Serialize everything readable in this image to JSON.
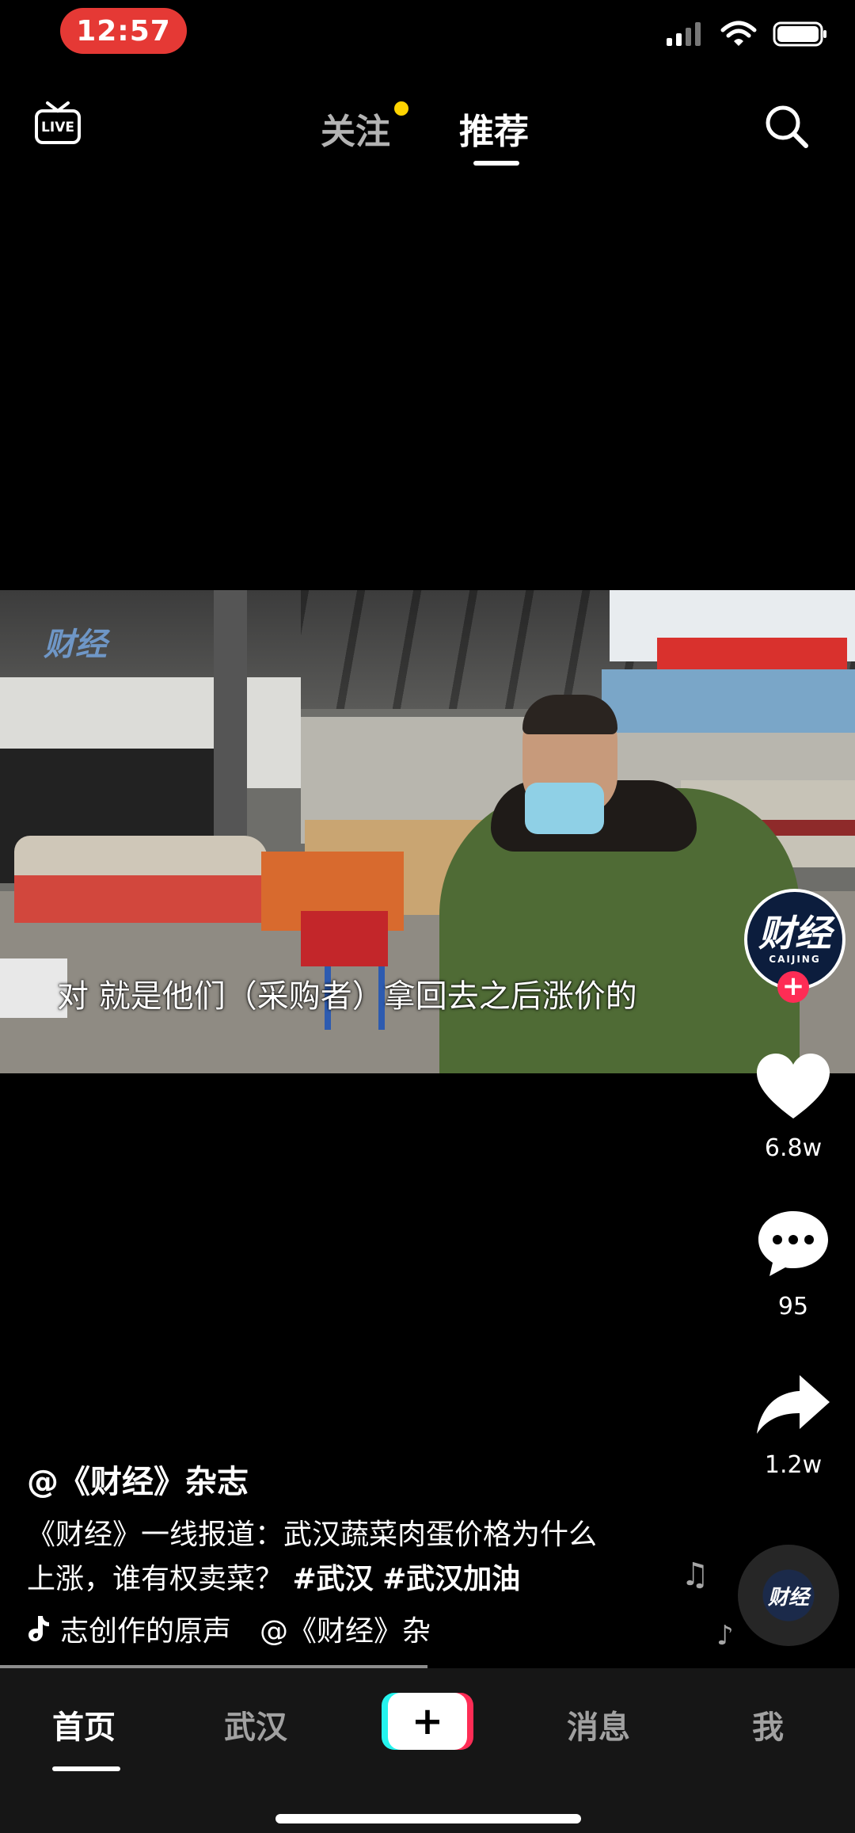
{
  "status_bar": {
    "time": "12:57"
  },
  "top_nav": {
    "live_label": "LIVE",
    "tab_follow": "关注",
    "tab_recommend": "推荐"
  },
  "video": {
    "watermark": "财经",
    "subtitle": "对 就是他们（采购者）拿回去之后涨价的"
  },
  "actions": {
    "avatar_text": "财经",
    "avatar_sub": "CAIJING",
    "follow_plus": "+",
    "like_count": "6.8w",
    "comment_count": "95",
    "share_count": "1.2w"
  },
  "caption": {
    "author": "@《财经》杂志",
    "desc_line1": "《财经》一线报道：武汉蔬菜肉蛋价格为什么",
    "desc_line2_text": "上涨，谁有权卖菜？",
    "hashtags": [
      "#武汉",
      "#武汉加油"
    ],
    "music": "志创作的原声　@《财经》杂"
  },
  "disc_label": "财经",
  "bottom_nav": {
    "home": "首页",
    "wuhan": "武汉",
    "plus": "+",
    "messages": "消息",
    "me": "我"
  },
  "colors": {
    "accent_red": "#fe2c55",
    "accent_cyan": "#25f4ee",
    "follow_dot": "#ffd400",
    "time_pill": "#e53935"
  }
}
